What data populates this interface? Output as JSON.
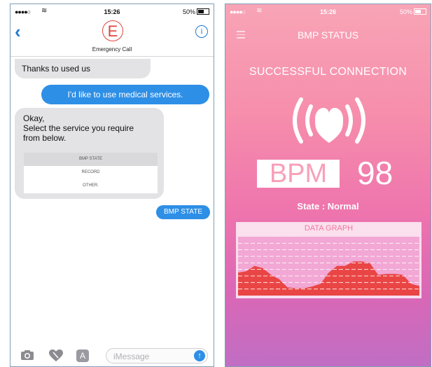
{
  "left": {
    "status": {
      "carrier": "●●●●○",
      "time": "15:26",
      "battery": "50%"
    },
    "header": {
      "avatar_letter": "E",
      "title": "Emergency Call",
      "back_glyph": "‹",
      "info_glyph": "i"
    },
    "messages": {
      "m1": "Thanks to used us",
      "m2": "I'd like to use medical services.",
      "m3_line1": "Okay,",
      "m3_line2": "Select the service you require",
      "m3_line3": "from below.",
      "options": [
        "BMP STATE",
        "RECORD",
        "OTHER."
      ],
      "m4": "BMP STATE"
    },
    "toolbar": {
      "input_placeholder": "iMessage",
      "send_glyph": "↑"
    }
  },
  "right": {
    "status": {
      "carrier": "●●●●○",
      "time": "15:26",
      "battery": "50%"
    },
    "title": "BMP STATUS",
    "connection": "SUCCESSFUL CONNECTION",
    "bpm_label": "BPM",
    "bpm_value": "98",
    "state": "State : Normal",
    "graph": {
      "title": "DATA GRAPH",
      "colors": {
        "fill": "#ea4545",
        "grid": "#ffffff",
        "bg": "#f2a7d4"
      },
      "values": [
        0.45,
        0.48,
        0.6,
        0.55,
        0.4,
        0.3,
        0.12,
        0.1,
        0.1,
        0.14,
        0.2,
        0.45,
        0.6,
        0.6,
        0.7,
        0.7,
        0.66,
        0.4,
        0.42,
        0.42,
        0.4,
        0.2,
        0.15
      ]
    },
    "accent_color": "#f8a0b8"
  }
}
